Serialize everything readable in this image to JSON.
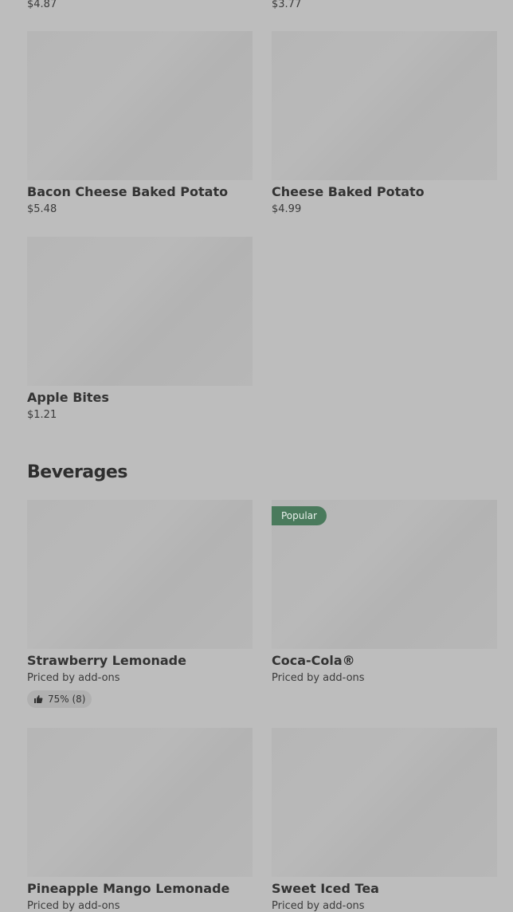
{
  "top_prices": [
    "$4.87",
    "$3.77"
  ],
  "items_top": [
    {
      "name": "Bacon Cheese Baked Potato",
      "price": "$5.48"
    },
    {
      "name": "Cheese Baked Potato",
      "price": "$4.99"
    },
    {
      "name": "Apple Bites",
      "price": "$1.21"
    }
  ],
  "beverages": {
    "heading": "Beverages",
    "items": [
      {
        "name": "Strawberry Lemonade",
        "subtitle": "Priced by add-ons",
        "rating": "75% (8)"
      },
      {
        "name": "Coca-Cola®",
        "subtitle": "Priced by add-ons",
        "badge": "Popular"
      },
      {
        "name": "Pineapple Mango Lemonade",
        "subtitle": "Priced by add-ons"
      },
      {
        "name": "Sweet Iced Tea",
        "subtitle": "Priced by add-ons"
      }
    ]
  },
  "icons": {
    "rating": "thumbs-up-icon"
  }
}
